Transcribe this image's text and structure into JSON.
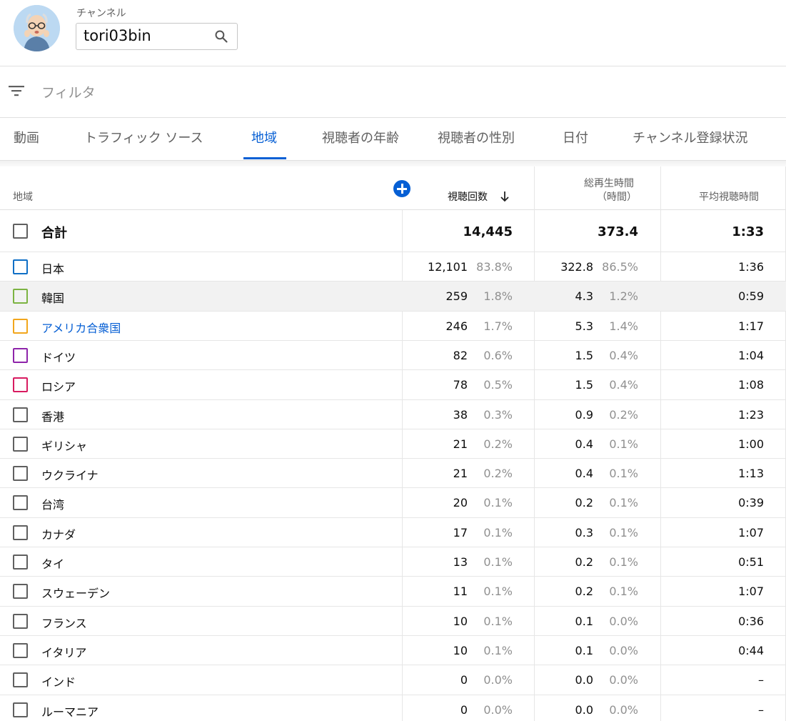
{
  "channel": {
    "label": "チャンネル",
    "value": "tori03bin"
  },
  "filter": {
    "placeholder": "フィルタ"
  },
  "tabs": [
    "動画",
    "トラフィック ソース",
    "地域",
    "視聴者の年齢",
    "視聴者の性別",
    "日付",
    "チャンネル登録状況"
  ],
  "active_tab": "地域",
  "colors": {
    "accent": "#065fd4",
    "japan": "#0f6fc6",
    "korea": "#7cb342",
    "usa": "#f2a61c",
    "germany": "#8e24aa",
    "russia": "#d81b60"
  },
  "table": {
    "headers": {
      "region": "地域",
      "views": "視聴回数",
      "watch_time_line1": "総再生時間",
      "watch_time_line2": "（時間）",
      "avg": "平均視聴時間"
    },
    "total": {
      "label": "合計",
      "views": "14,445",
      "watch": "373.4",
      "avg": "1:33"
    },
    "rows": [
      {
        "name": "日本",
        "views": "12,101",
        "views_pct": "83.8%",
        "watch": "322.8",
        "watch_pct": "86.5%",
        "avg": "1:36",
        "color": "#0f6fc6"
      },
      {
        "name": "韓国",
        "views": "259",
        "views_pct": "1.8%",
        "watch": "4.3",
        "watch_pct": "1.2%",
        "avg": "0:59",
        "color": "#7cb342"
      },
      {
        "name": "アメリカ合衆国",
        "views": "246",
        "views_pct": "1.7%",
        "watch": "5.3",
        "watch_pct": "1.4%",
        "avg": "1:17",
        "color": "#f2a61c"
      },
      {
        "name": "ドイツ",
        "views": "82",
        "views_pct": "0.6%",
        "watch": "1.5",
        "watch_pct": "0.4%",
        "avg": "1:04",
        "color": "#8e24aa"
      },
      {
        "name": "ロシア",
        "views": "78",
        "views_pct": "0.5%",
        "watch": "1.5",
        "watch_pct": "0.4%",
        "avg": "1:08",
        "color": "#d81b60"
      },
      {
        "name": "香港",
        "views": "38",
        "views_pct": "0.3%",
        "watch": "0.9",
        "watch_pct": "0.2%",
        "avg": "1:23"
      },
      {
        "name": "ギリシャ",
        "views": "21",
        "views_pct": "0.2%",
        "watch": "0.4",
        "watch_pct": "0.1%",
        "avg": "1:00"
      },
      {
        "name": "ウクライナ",
        "views": "21",
        "views_pct": "0.2%",
        "watch": "0.4",
        "watch_pct": "0.1%",
        "avg": "1:13"
      },
      {
        "name": "台湾",
        "views": "20",
        "views_pct": "0.1%",
        "watch": "0.2",
        "watch_pct": "0.1%",
        "avg": "0:39"
      },
      {
        "name": "カナダ",
        "views": "17",
        "views_pct": "0.1%",
        "watch": "0.3",
        "watch_pct": "0.1%",
        "avg": "1:07"
      },
      {
        "name": "タイ",
        "views": "13",
        "views_pct": "0.1%",
        "watch": "0.2",
        "watch_pct": "0.1%",
        "avg": "0:51"
      },
      {
        "name": "スウェーデン",
        "views": "11",
        "views_pct": "0.1%",
        "watch": "0.2",
        "watch_pct": "0.1%",
        "avg": "1:07"
      },
      {
        "name": "フランス",
        "views": "10",
        "views_pct": "0.1%",
        "watch": "0.1",
        "watch_pct": "0.0%",
        "avg": "0:36"
      },
      {
        "name": "イタリア",
        "views": "10",
        "views_pct": "0.1%",
        "watch": "0.1",
        "watch_pct": "0.0%",
        "avg": "0:44"
      },
      {
        "name": "インド",
        "views": "0",
        "views_pct": "0.0%",
        "watch": "0.0",
        "watch_pct": "0.0%",
        "avg": "–"
      },
      {
        "name": "ルーマニア",
        "views": "0",
        "views_pct": "0.0%",
        "watch": "0.0",
        "watch_pct": "0.0%",
        "avg": "–"
      }
    ]
  }
}
